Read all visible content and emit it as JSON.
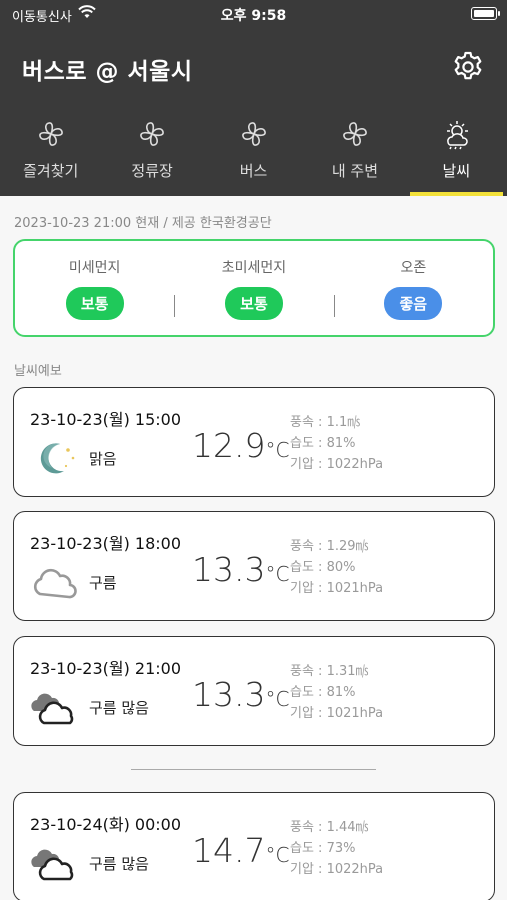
{
  "status_bar": {
    "carrier": "이동통신사",
    "time": "오후 9:58"
  },
  "header": {
    "title": "버스로 @ 서울시"
  },
  "tabs": [
    {
      "label": "즐겨찾기",
      "icon": "fan-icon"
    },
    {
      "label": "정류장",
      "icon": "fan-icon"
    },
    {
      "label": "버스",
      "icon": "fan-icon"
    },
    {
      "label": "내 주변",
      "icon": "fan-icon"
    },
    {
      "label": "날씨",
      "icon": "weather-icon",
      "active": true
    }
  ],
  "as_of": "2023-10-23 21:00 현재 / 제공 한국환경공단",
  "air_quality": [
    {
      "label": "미세먼지",
      "grade": "보통",
      "color": "#1fc95a"
    },
    {
      "label": "초미세먼지",
      "grade": "보통",
      "color": "#1fc95a"
    },
    {
      "label": "오존",
      "grade": "좋음",
      "color": "#4a8fe8"
    }
  ],
  "forecast_title": "날씨예보",
  "forecasts": [
    {
      "time": "23-10-23(월) 15:00",
      "icon": "moon-icon",
      "condition": "맑음",
      "temp": "12.9",
      "unit": "°C",
      "wind": "풍속 : 1.1㎧",
      "humidity": "습도 : 81%",
      "pressure": "기압 : 1022hPa"
    },
    {
      "time": "23-10-23(월) 18:00",
      "icon": "cloud-icon",
      "condition": "구름",
      "temp": "13.3",
      "unit": "°C",
      "wind": "풍속 : 1.29㎧",
      "humidity": "습도 : 80%",
      "pressure": "기압 : 1021hPa"
    },
    {
      "time": "23-10-23(월) 21:00",
      "icon": "clouds-icon",
      "condition": "구름 많음",
      "temp": "13.3",
      "unit": "°C",
      "wind": "풍속 : 1.31㎧",
      "humidity": "습도 : 81%",
      "pressure": "기압 : 1021hPa"
    },
    {
      "time": "23-10-24(화) 00:00",
      "icon": "clouds-icon",
      "condition": "구름 많음",
      "temp": "14.7",
      "unit": "°C",
      "wind": "풍속 : 1.44㎧",
      "humidity": "습도 : 73%",
      "pressure": "기압 : 1022hPa"
    }
  ]
}
